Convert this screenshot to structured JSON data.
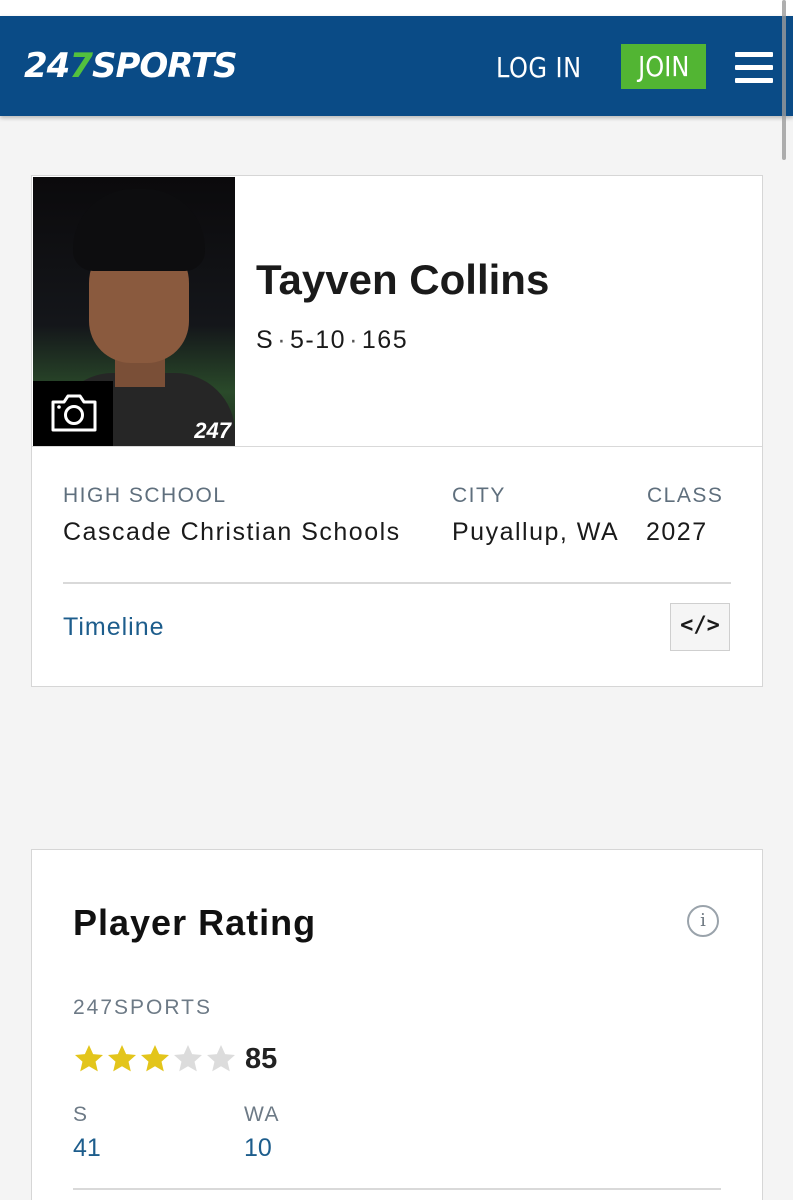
{
  "header": {
    "logo_prefix": "24",
    "logo_accent": "7",
    "logo_suffix": "SPORTS",
    "login_label": "LOG IN",
    "join_label": "JOIN",
    "colors": {
      "bar": "#0a4b86",
      "join": "#52b533"
    }
  },
  "player": {
    "photo_watermark": "247",
    "name": "Tayven Collins",
    "position": "S",
    "height": "5-10",
    "weight": "165",
    "separator": "·",
    "high_school_label": "HIGH SCHOOL",
    "high_school": "Cascade Christian Schools",
    "city_label": "CITY",
    "city": "Puyallup, WA",
    "class_label": "CLASS",
    "class_year": "2027",
    "timeline_label": "Timeline",
    "embed_label": "</>"
  },
  "rating": {
    "title": "Player Rating",
    "info_label": "i",
    "source": "247SPORTS",
    "stars": 3,
    "max_stars": 5,
    "score": "85",
    "rank_position_label": "S",
    "rank_position_value": "41",
    "rank_state_label": "WA",
    "rank_state_value": "10",
    "colors": {
      "star_on": "#e3c51b",
      "star_off": "#dcdcdc"
    }
  }
}
